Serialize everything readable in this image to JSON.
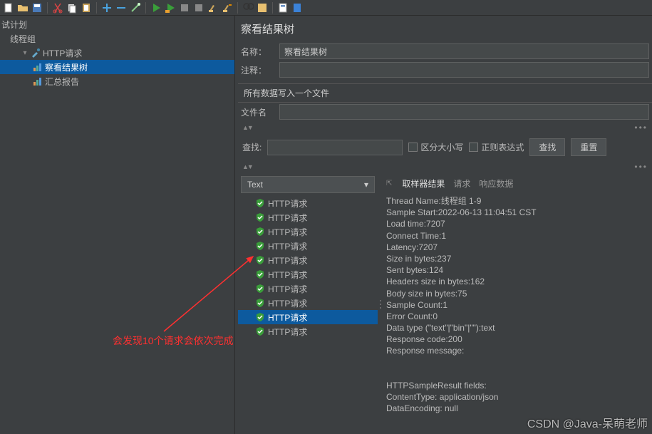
{
  "toolbar_icons": [
    "new",
    "open",
    "save",
    "cut",
    "copy",
    "paste",
    "sep",
    "plus",
    "minus",
    "wand",
    "sep",
    "play",
    "play-green",
    "stop",
    "stop-all",
    "shutdown",
    "sep",
    "broom",
    "broom2",
    "sep",
    "search",
    "fn",
    "sep",
    "doc",
    "blue-doc"
  ],
  "tree": {
    "root": "试计划",
    "thread_group": "线程组",
    "http_request": "HTTP请求",
    "view_results_tree": "察看结果树",
    "summary_report": "汇总报告"
  },
  "annotation": "会发现10个请求会依次完成",
  "panel": {
    "title": "察看结果树",
    "name_label": "名称：",
    "name_value": "察看结果树",
    "comment_label": "注释：",
    "comment_value": "",
    "file_section": "所有数据写入一个文件",
    "filename_label": "文件名",
    "filename_value": "",
    "search_label": "查找:",
    "case_sensitive": "区分大小写",
    "regex": "正则表达式",
    "search_btn": "查找",
    "reset_btn": "重置",
    "dropdown_value": "Text"
  },
  "results": [
    "HTTP请求",
    "HTTP请求",
    "HTTP请求",
    "HTTP请求",
    "HTTP请求",
    "HTTP请求",
    "HTTP请求",
    "HTTP请求",
    "HTTP请求",
    "HTTP请求"
  ],
  "selected_result_index": 8,
  "tabs": {
    "sampler": "取样器结果",
    "request": "请求",
    "response": "响应数据"
  },
  "details": [
    "Thread Name:线程组 1-9",
    "Sample Start:2022-06-13 11:04:51 CST",
    "Load time:7207",
    "Connect Time:1",
    "Latency:7207",
    "Size in bytes:237",
    "Sent bytes:124",
    "Headers size in bytes:162",
    "Body size in bytes:75",
    "Sample Count:1",
    "Error Count:0",
    "Data type (\"text\"|\"bin\"|\"\"):text",
    "Response code:200",
    "Response message:",
    "",
    "",
    "HTTPSampleResult fields:",
    "ContentType: application/json",
    "DataEncoding: null"
  ],
  "watermark": "CSDN @Java-呆萌老师"
}
